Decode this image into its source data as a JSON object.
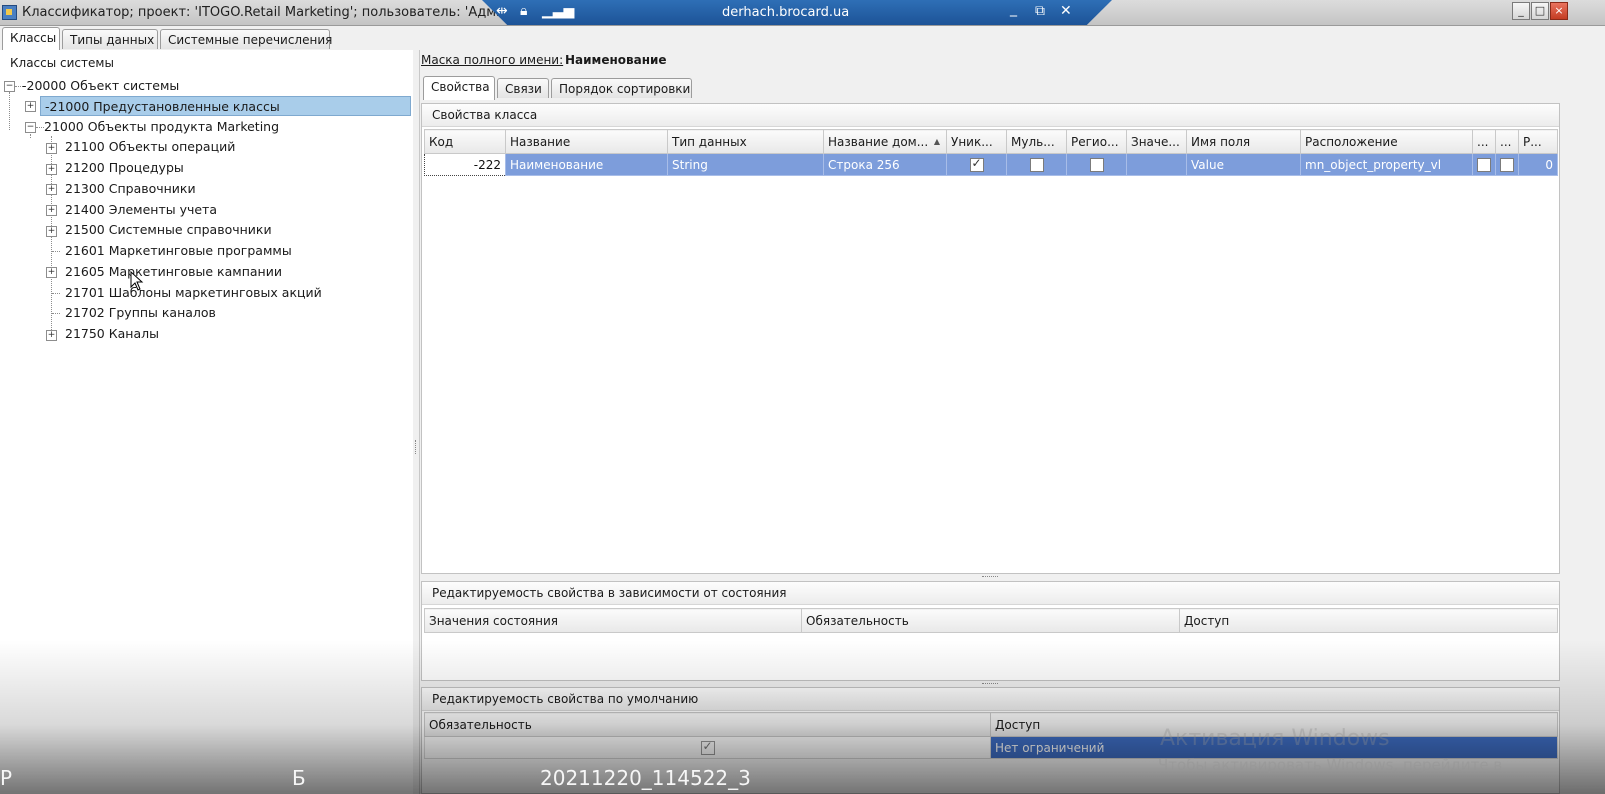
{
  "window": {
    "title": "Классификатор; проект: 'ITOGO.Retail Marketing'; пользователь: 'Администратор'",
    "remote_host": "derhach.brocard.ua",
    "btn_minimize": "_",
    "btn_maximize": "□",
    "btn_close": "×"
  },
  "top_tabs": [
    "Классы",
    "Типы данных",
    "Системные перечисления"
  ],
  "tree": {
    "caption": "Классы системы",
    "items": [
      {
        "label": "-20000 Объект системы"
      },
      {
        "label": "-21000 Предустановленные классы"
      },
      {
        "label": "21000 Объекты продукта Marketing"
      },
      {
        "label": "21100 Объекты операций"
      },
      {
        "label": "21200 Процедуры"
      },
      {
        "label": "21300 Справочники"
      },
      {
        "label": "21400 Элементы учета"
      },
      {
        "label": "21500 Системные справочники"
      },
      {
        "label": "21601 Маркетинговые программы"
      },
      {
        "label": "21605 Маркетинговые кампании"
      },
      {
        "label": "21701 Шаблоны маркетинговых акций"
      },
      {
        "label": "21702 Группы каналов"
      },
      {
        "label": "21750 Каналы"
      }
    ]
  },
  "mask": {
    "label": "Маска полного имени:",
    "value": "Наименование"
  },
  "sub_tabs": [
    "Свойства",
    "Связи",
    "Порядок сортировки"
  ],
  "class_props": {
    "caption": "Свойства класса",
    "columns": [
      "Код",
      "Название",
      "Тип данных",
      "Название дом...",
      "Уник...",
      "Муль...",
      "Регио...",
      "Значе...",
      "Имя поля",
      "Расположение",
      "...",
      "...",
      "Р..."
    ],
    "row": {
      "code": "-222",
      "name": "Наименование",
      "data_type": "String",
      "domain_name": "Строка 256",
      "field_name": "Value",
      "location": "mn_object_property_vl",
      "last": "0"
    }
  },
  "state_edit": {
    "caption": "Редактируемость свойства в зависимости от состояния",
    "columns": [
      "Значения состояния",
      "Обязательность",
      "Доступ"
    ]
  },
  "default_edit": {
    "caption": "Редактируемость свойства по умолчанию",
    "columns": [
      "Обязательность",
      "Доступ"
    ],
    "access_value": "Нет ограничений"
  },
  "overlay": {
    "line1_left": "Р",
    "line1_mid": "Б",
    "line1_right": "20211220_114522_3"
  },
  "watermark": {
    "line1": "Активация Windows",
    "line2": "Чтобы активировать Windows, перейдите в"
  }
}
